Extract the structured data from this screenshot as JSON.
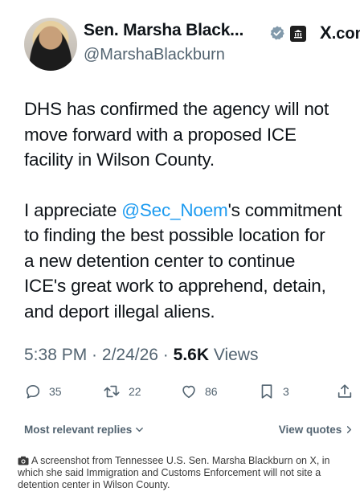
{
  "header": {
    "display_name": "Sen. Marsha Black...",
    "handle": "@MarshaBlackburn",
    "brand": "X",
    "brand_suffix": ".com"
  },
  "tweet": {
    "p1": "DHS has confirmed the agency will not",
    "p2": "move forward with a proposed ICE",
    "p3": "facility in Wilson County.",
    "q1_pre": "I appreciate ",
    "q1_mention": "@Sec_Noem",
    "q1_post": "'s commitment",
    "q2": "to finding the best possible location for",
    "q3": "a new detention center to continue",
    "q4": "ICE's great work to apprehend, detain,",
    "q5": "and deport illegal aliens."
  },
  "meta": {
    "time": "5:38 PM",
    "sep": " · ",
    "date": "2/24/26",
    "views_count": "5.6K",
    "views_label": " Views"
  },
  "actions": {
    "replies": "35",
    "reposts": "22",
    "likes": "86",
    "bookmarks": "3"
  },
  "replies_bar": {
    "sort_label": "Most relevant replies",
    "quotes_label": "View quotes"
  },
  "caption": {
    "text": "A screenshot from Tennessee U.S. Sen. Marsha Blackburn on X, in which she said Immigration and Customs Enforcement will not site a detention center in Wilson County."
  },
  "colors": {
    "link": "#1d9bf0",
    "secondary": "#536471",
    "text": "#0f1419"
  }
}
